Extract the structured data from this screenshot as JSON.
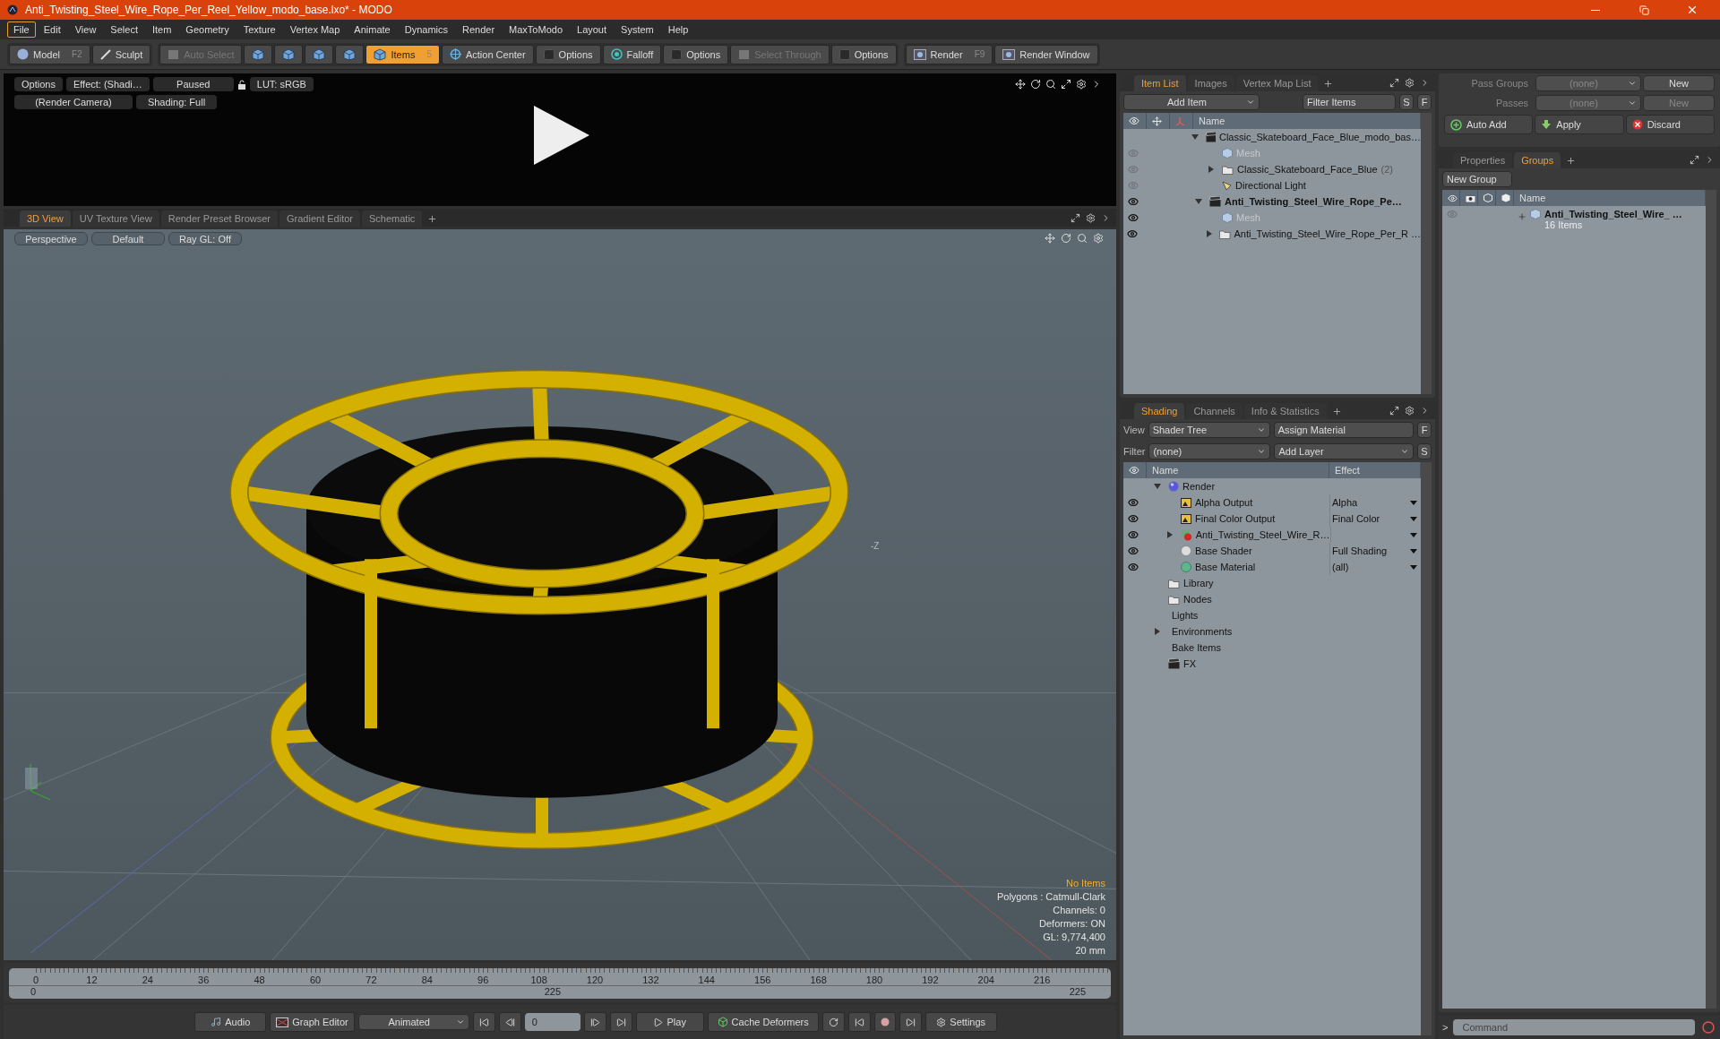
{
  "window": {
    "title": "Anti_Twisting_Steel_Wire_Rope_Per_Reel_Yellow_modo_base.lxo* - MODO"
  },
  "menu": [
    {
      "label": "File",
      "selected": true
    },
    {
      "label": "Edit",
      "selected": false
    },
    {
      "label": "View",
      "selected": false
    },
    {
      "label": "Select",
      "selected": false
    },
    {
      "label": "Item",
      "selected": false
    },
    {
      "label": "Geometry",
      "selected": false
    },
    {
      "label": "Texture",
      "selected": false
    },
    {
      "label": "Vertex Map",
      "selected": false
    },
    {
      "label": "Animate",
      "selected": false
    },
    {
      "label": "Dynamics",
      "selected": false
    },
    {
      "label": "Render",
      "selected": false
    },
    {
      "label": "MaxToModo",
      "selected": false
    },
    {
      "label": "Layout",
      "selected": false
    },
    {
      "label": "System",
      "selected": false
    },
    {
      "label": "Help",
      "selected": false
    }
  ],
  "toolbar": [
    [
      {
        "kind": "mode",
        "label": "Model",
        "shortcut": "F2"
      },
      {
        "kind": "tool",
        "label": "Sculpt"
      }
    ],
    [
      {
        "kind": "select",
        "label": "Auto Select",
        "disabled": true
      },
      {
        "kind": "cube"
      },
      {
        "kind": "cube"
      },
      {
        "kind": "cube"
      },
      {
        "kind": "cube"
      },
      {
        "kind": "cube",
        "label": "Items",
        "shortcut": "5",
        "active": true
      },
      {
        "kind": "target",
        "label": "Action Center"
      },
      {
        "kind": "check",
        "label": "Options"
      },
      {
        "kind": "ring",
        "label": "Falloff"
      },
      {
        "kind": "check",
        "label": "Options"
      },
      {
        "kind": "select",
        "label": "Select Through",
        "disabled": true
      },
      {
        "kind": "check",
        "label": "Options"
      }
    ],
    [
      {
        "kind": "render",
        "label": "Render",
        "shortcut": "F9"
      },
      {
        "kind": "render",
        "label": "Render Window"
      }
    ]
  ],
  "preview": {
    "row_1": [
      "Options",
      "Effect: (Shadi…",
      "Paused"
    ],
    "lut": "LUT: sRGB",
    "row_2": [
      "(Render Camera)",
      "Shading: Full"
    ]
  },
  "viewport_tabs": [
    {
      "label": "3D View",
      "selected": true
    },
    {
      "label": "UV Texture View",
      "selected": false
    },
    {
      "label": "Render Preset Browser",
      "selected": false
    },
    {
      "label": "Gradient Editor",
      "selected": false
    },
    {
      "label": "Schematic",
      "selected": false
    }
  ],
  "viewport_buttons": [
    "Perspective",
    "Default",
    "Ray GL: Off"
  ],
  "viewport": {
    "axis_label": "-Z",
    "info": [
      {
        "text": "No Items",
        "highlight": true
      },
      {
        "text": "Polygons : Catmull-Clark",
        "highlight": false
      },
      {
        "text": "Channels: 0",
        "highlight": false
      },
      {
        "text": "Deformers: ON",
        "highlight": false
      },
      {
        "text": "GL: 9,774,400",
        "highlight": false
      },
      {
        "text": "20 mm",
        "highlight": false
      }
    ]
  },
  "timeline": {
    "ticks": [
      "0",
      "12",
      "24",
      "36",
      "48",
      "60",
      "72",
      "84",
      "96",
      "108",
      "120",
      "132",
      "144",
      "156",
      "168",
      "180",
      "192",
      "204",
      "216"
    ],
    "start": "0",
    "middle": "225",
    "end": "225"
  },
  "transport": {
    "audio": "Audio",
    "graph_editor": "Graph Editor",
    "mode": "Animated",
    "frame": "0",
    "play": "Play",
    "cache": "Cache Deformers",
    "settings": "Settings"
  },
  "item_list": {
    "tabs": [
      {
        "label": "Item List",
        "selected": true
      },
      {
        "label": "Images",
        "selected": false
      },
      {
        "label": "Vertex Map List",
        "selected": false
      }
    ],
    "add_item": "Add Item",
    "filter": "Filter Items",
    "s_button": "S",
    "f_button": "F",
    "column": "Name",
    "items": [
      {
        "name": "Classic_Skateboard_Face_Blue_modo_bas…",
        "kind": "scene",
        "current": false,
        "expanded": true,
        "children": [
          {
            "name": "Mesh",
            "kind": "mesh",
            "visible": false,
            "dimmed": true
          },
          {
            "name": "Classic_Skateboard_Face_Blue",
            "count": "(2)",
            "kind": "folder",
            "visible": false,
            "expanded": false
          },
          {
            "name": "Directional Light",
            "kind": "light",
            "visible": false
          }
        ]
      },
      {
        "name": "Anti_Twisting_Steel_Wire_Rope_Pe…",
        "kind": "scene",
        "current": true,
        "visible": true,
        "expanded": true,
        "children": [
          {
            "name": "Mesh",
            "kind": "mesh",
            "visible": true,
            "dimmed": true
          },
          {
            "name": "Anti_Twisting_Steel_Wire_Rope_Per_R …",
            "kind": "folder",
            "visible": true,
            "expanded": false
          }
        ]
      }
    ]
  },
  "shading": {
    "tabs": [
      {
        "label": "Shading",
        "selected": true
      },
      {
        "label": "Channels",
        "selected": false
      },
      {
        "label": "Info & Statistics",
        "selected": false
      }
    ],
    "view_label": "View",
    "view": "Shader Tree",
    "assign": "Assign Material",
    "f_button": "F",
    "filter_label": "Filter",
    "filter": "(none)",
    "add_layer": "Add Layer",
    "s_button": "S",
    "columns": [
      "Name",
      "Effect"
    ],
    "items": [
      {
        "name": "Render",
        "kind": "render",
        "expanded": true,
        "children": [
          {
            "name": "Alpha Output",
            "kind": "output",
            "eye": true,
            "has_menu": true,
            "effect": "Alpha"
          },
          {
            "name": "Final Color Output",
            "kind": "output",
            "eye": true,
            "has_menu": true,
            "effect": "Final Color"
          },
          {
            "name": "Anti_Twisting_Steel_Wire_R…",
            "kind": "group",
            "eye": true,
            "has_menu": true,
            "expanded": false
          },
          {
            "name": "Base Shader",
            "kind": "shader",
            "eye": true,
            "has_menu": true,
            "effect": "Full Shading"
          },
          {
            "name": "Base Material",
            "kind": "material",
            "eye": true,
            "has_menu": true,
            "effect": "(all)"
          }
        ]
      },
      {
        "name": "Library",
        "kind": "folder"
      },
      {
        "name": "Nodes",
        "kind": "folder"
      },
      {
        "name": "Lights",
        "kind": "plain"
      },
      {
        "name": "Environments",
        "kind": "plain",
        "expanded": false
      },
      {
        "name": "Bake Items",
        "kind": "plain"
      },
      {
        "name": "FX",
        "kind": "fx"
      }
    ]
  },
  "passes": {
    "pass_groups_label": "Pass Groups",
    "pass_groups": "(none)",
    "passes_label": "Passes",
    "passes": "(none)",
    "new_1": "New",
    "new_2": "New",
    "auto_add": "Auto Add",
    "apply": "Apply",
    "discard": "Discard"
  },
  "groups": {
    "tabs": [
      {
        "label": "Properties",
        "selected": false
      },
      {
        "label": "Groups",
        "selected": true
      }
    ],
    "new_group": "New Group",
    "column": "Name",
    "rows": [
      {
        "name": "Anti_Twisting_Steel_Wire_ …",
        "count": "16 Items"
      }
    ]
  },
  "command": {
    "prompt": ">",
    "placeholder": "Command"
  }
}
